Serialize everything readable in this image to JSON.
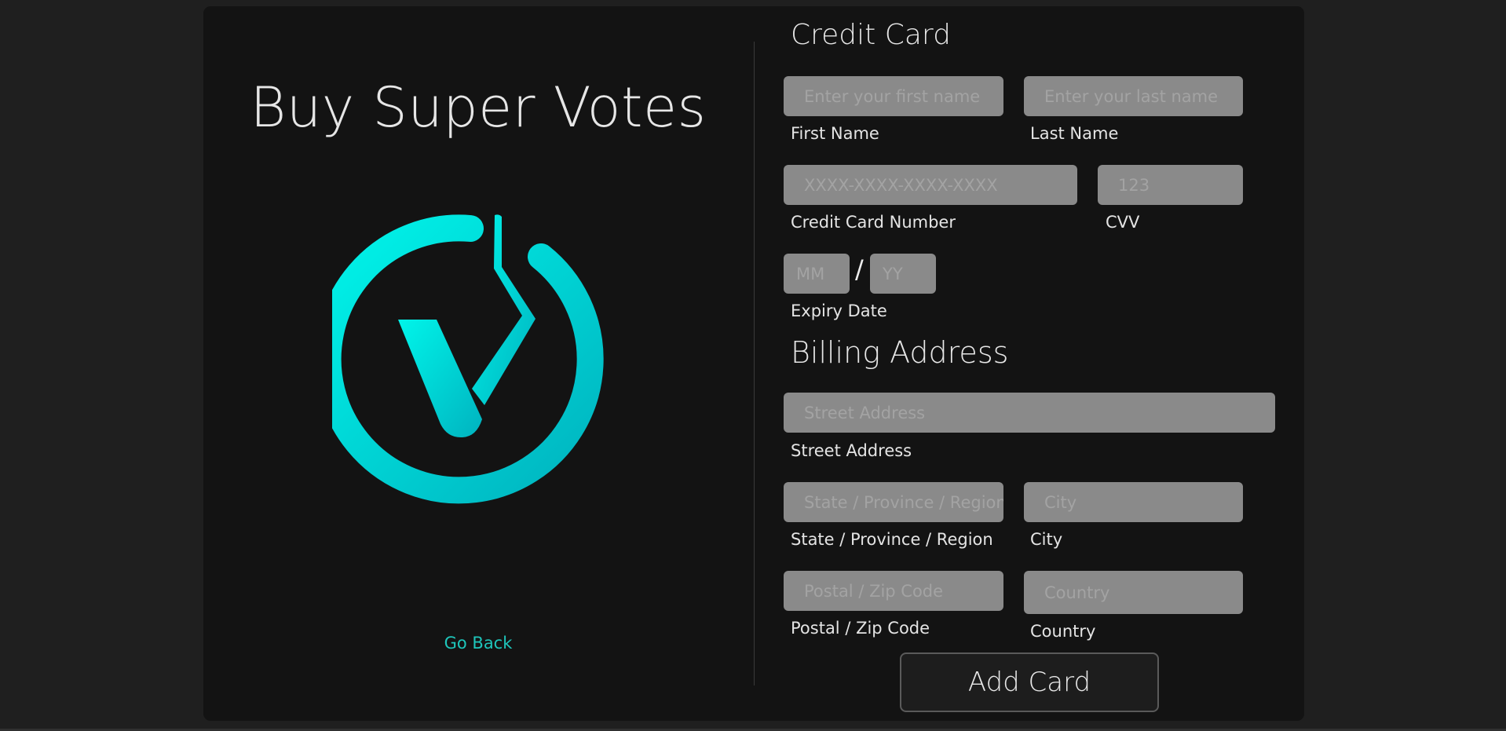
{
  "left_panel": {
    "title": "Buy Super Votes",
    "logo": {
      "icon": "super-votes-logo-icon",
      "color_start": "#00f0e6",
      "color_end": "#00b8c4"
    },
    "go_back_label": "Go Back"
  },
  "credit_card": {
    "title": "Credit Card",
    "first_name": {
      "placeholder": "Enter your first name",
      "label": "First Name"
    },
    "last_name": {
      "placeholder": "Enter your last name",
      "label": "Last Name"
    },
    "card_number": {
      "placeholder": "XXXX-XXXX-XXXX-XXXX",
      "label": "Credit Card Number"
    },
    "cvv": {
      "placeholder": "123",
      "label": "CVV"
    },
    "expiry": {
      "month_placeholder": "MM",
      "separator": "/",
      "year_placeholder": "YY",
      "label": "Expiry Date"
    }
  },
  "billing": {
    "title": "Billing Address",
    "street": {
      "placeholder": "Street Address",
      "label": "Street Address"
    },
    "state": {
      "placeholder": "State / Province / Region",
      "label": "State / Province / Region"
    },
    "city": {
      "placeholder": "City",
      "label": "City"
    },
    "postal": {
      "placeholder": "Postal / Zip Code",
      "label": "Postal / Zip Code"
    },
    "country": {
      "placeholder": "Country",
      "label": "Country"
    }
  },
  "submit_label": "Add Card",
  "colors": {
    "accent": "#1ec6bb",
    "background": "#1f1f1f",
    "panel": "#131313",
    "input": "#8a8a8a"
  }
}
